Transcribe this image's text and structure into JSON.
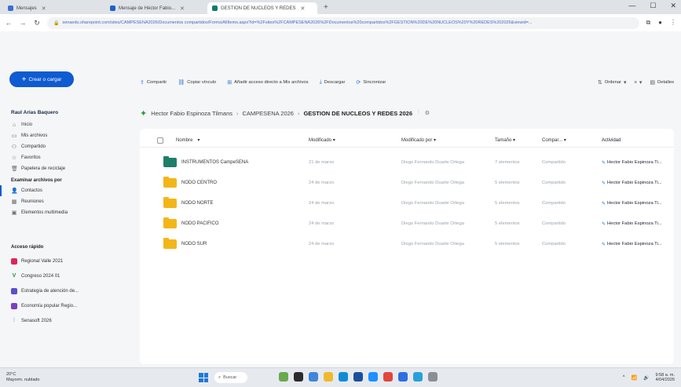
{
  "browser": {
    "tabs": [
      {
        "label": "Mensajes"
      },
      {
        "label": "Mensaje de Héctor Fabio..."
      },
      {
        "label": "GESTION DE NUCLEOS Y REDES"
      }
    ],
    "new_tab": "+",
    "window_controls": [
      "—",
      "☐",
      "✕"
    ],
    "address": "senaedu.sharepoint.com/sites/CAMPESENA2026/Documentos compartidos/Forms/AllItems.aspx?id=%2Fsites%2FCAMPESENA2026%2FDocumentos%20compartidos%2FGESTION%20DE%20NUCLEOS%20Y%20REDES%202026&viewid=..."
  },
  "sidebar": {
    "create_button": "Crear o cargar",
    "user_name": "Raul Arias Baquero",
    "nav": [
      {
        "label": "Inicio",
        "icon": "home-icon"
      },
      {
        "label": "Mis archivos",
        "icon": "folder-icon"
      },
      {
        "label": "Compartido",
        "icon": "people-icon"
      },
      {
        "label": "Favoritos",
        "icon": "star-icon"
      },
      {
        "label": "Papelera de reciclaje",
        "icon": "trash-icon"
      }
    ],
    "browse_title": "Examinar archivos por",
    "browse": [
      {
        "label": "Contactos",
        "icon": "person-icon",
        "selected": true
      },
      {
        "label": "Reuniones",
        "icon": "calendar-icon",
        "selected": false
      },
      {
        "label": "Elementos multimedia",
        "icon": "image-icon",
        "selected": false
      }
    ],
    "quick_title": "Acceso rápido",
    "quick": [
      {
        "label": "Regional Valle 2021",
        "color": "#d9285a"
      },
      {
        "label": "Congreso 2024 01",
        "color": "#2f8f3a"
      },
      {
        "label": "Estrategia de atención de...",
        "color": "#5a4fcf"
      },
      {
        "label": "Economía popular Regio...",
        "color": "#7b3fc4"
      },
      {
        "label": "Senasoft 2026",
        "color": "#1d72d8"
      }
    ]
  },
  "commands": {
    "left": [
      {
        "label": "Compartir",
        "icon": "share-icon"
      },
      {
        "label": "Copiar vínculo",
        "icon": "link-icon"
      },
      {
        "label": "Añadir acceso directo a Mis archivos",
        "icon": "shortcut-icon"
      },
      {
        "label": "Descargar",
        "icon": "download-icon"
      },
      {
        "label": "Sincronizar",
        "icon": "sync-icon"
      }
    ],
    "sort_label": "Ordenar",
    "view_label": "≡",
    "details_label": "Detalles"
  },
  "breadcrumb": {
    "items": [
      "Hector Fabio Espinoza Tilmans",
      "CAMPESENA 2026"
    ],
    "current": "GESTION DE NUCLEOS Y REDES 2026",
    "sep": "›"
  },
  "list": {
    "headers": {
      "name": "Nombre",
      "modified": "Modificado",
      "modified_by": "Modificado por",
      "size": "Tamaño",
      "share": "Compar...",
      "activity": "Actividad"
    },
    "rows": [
      {
        "name": "INSTRUMENTOS CampeSENA",
        "folder": "green",
        "modified": "21 de marzo",
        "by": "Diego Fernando Duarte Ortega",
        "size": "7 elementos",
        "share": "Compartido",
        "activity": "Hector Fabio Espinoza Ti..."
      },
      {
        "name": "NODO CENTRO",
        "folder": "yellow",
        "modified": "24 de marzo",
        "by": "Diego Fernando Duarte Ortega",
        "size": "5 elementos",
        "share": "Compartido",
        "activity": "Hector Fabio Espinoza Ti..."
      },
      {
        "name": "NODO NORTE",
        "folder": "yellow",
        "modified": "24 de marzo",
        "by": "Diego Fernando Duarte Ortega",
        "size": "5 elementos",
        "share": "Compartido",
        "activity": "Hector Fabio Espinoza Ti..."
      },
      {
        "name": "NODO PACIFICO",
        "folder": "yellow",
        "modified": "24 de marzo",
        "by": "Diego Fernando Duarte Ortega",
        "size": "5 elementos",
        "share": "Compartido",
        "activity": "Hector Fabio Espinoza Ti..."
      },
      {
        "name": "NODO SUR",
        "folder": "yellow",
        "modified": "24 de marzo",
        "by": "Diego Fernando Duarte Ortega",
        "size": "5 elementos",
        "share": "Compartido",
        "activity": "Hector Fabio Espinoza Ti..."
      }
    ]
  },
  "taskbar": {
    "weather_line1": "20°C",
    "weather_line2": "Mayorm. nublado",
    "search": "Buscar",
    "clock_line1": "9:58 a. m.",
    "clock_line2": "4/04/2026"
  }
}
